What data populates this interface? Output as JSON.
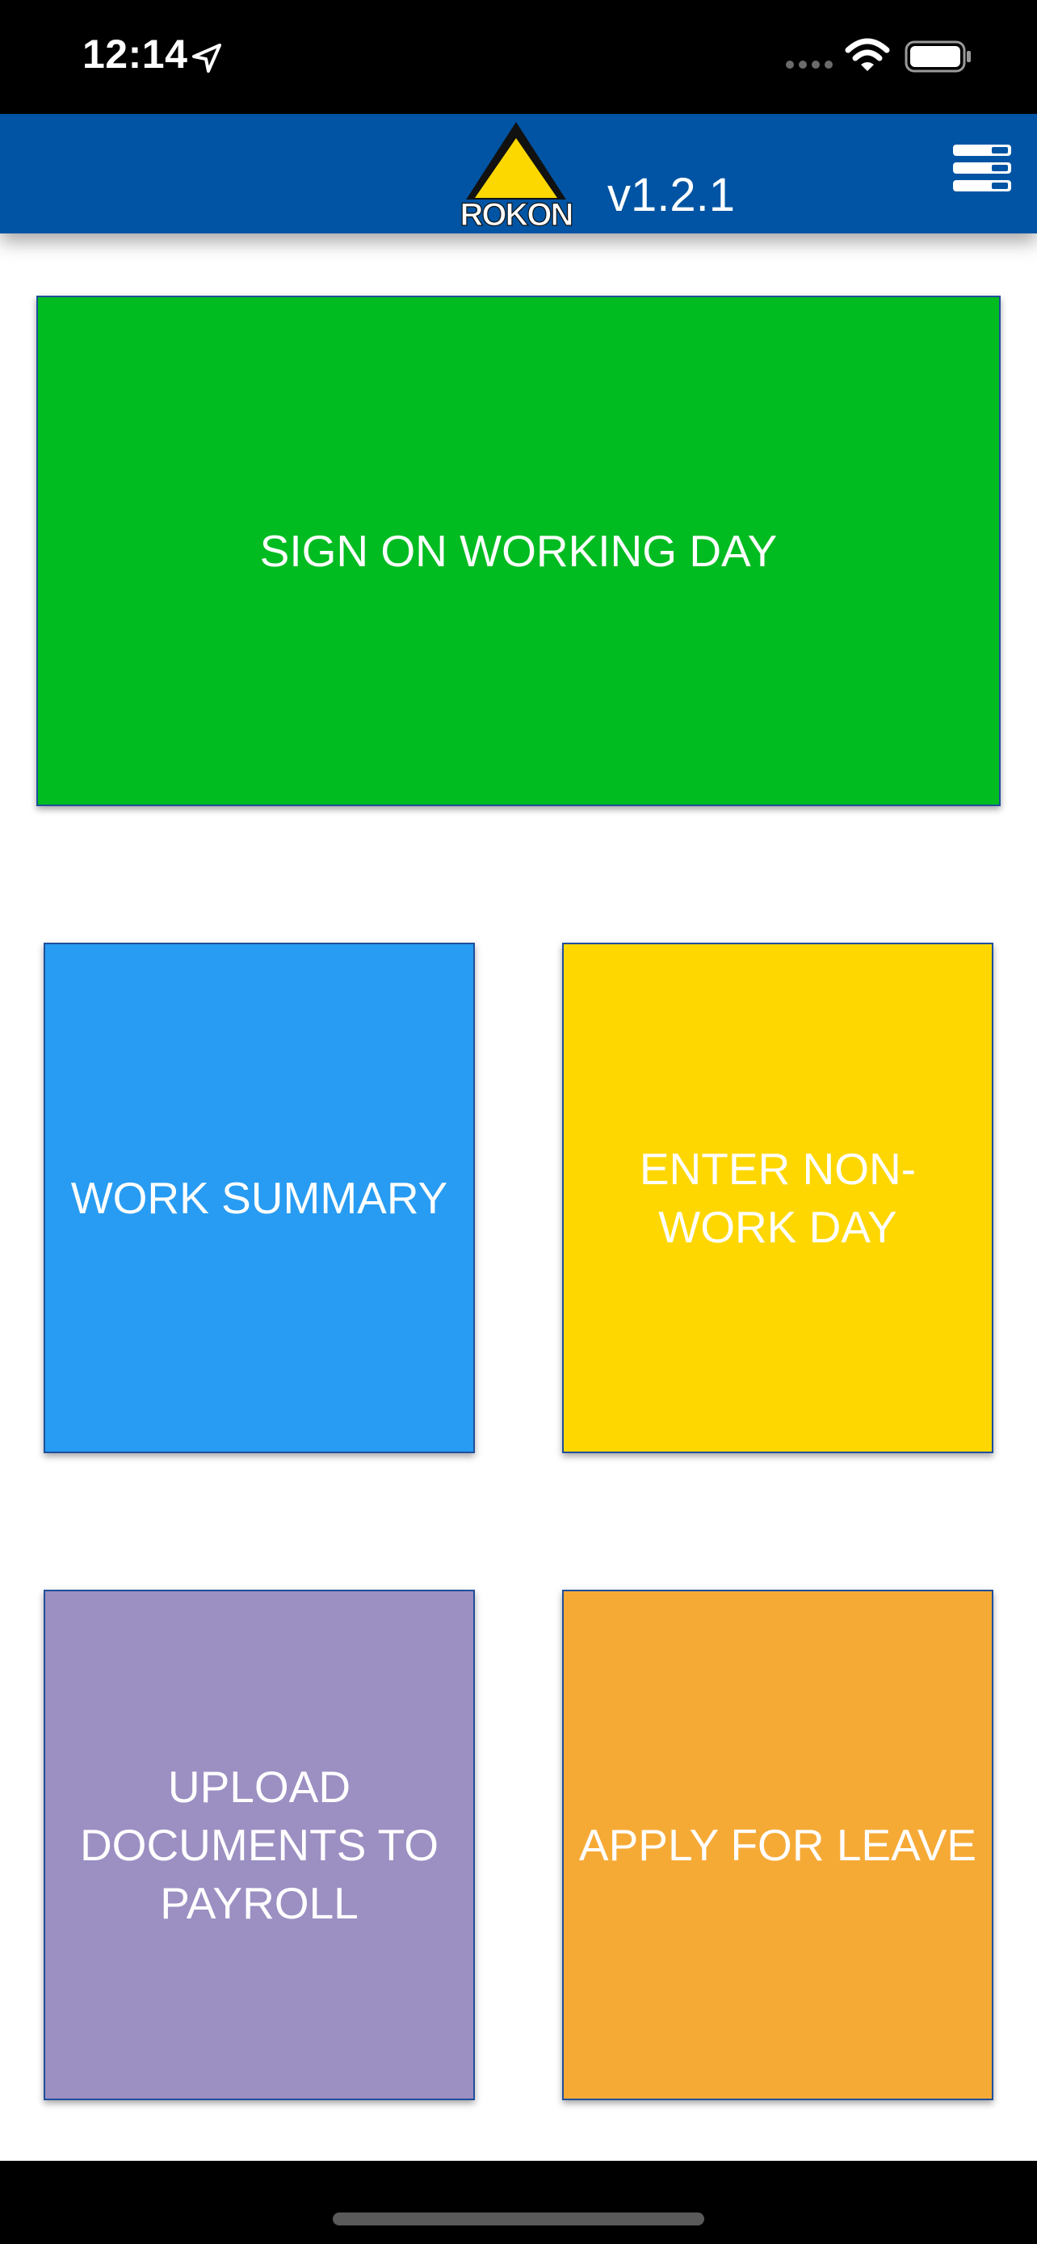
{
  "status_bar": {
    "time": "12:14"
  },
  "header": {
    "logo_text": "ROKON",
    "version": "v1.2.1",
    "menu_icon": "menu-stack-icon"
  },
  "tiles": {
    "sign_on": "SIGN ON WORKING DAY",
    "work_summary": "WORK SUMMARY",
    "non_work_day": "ENTER NON-WORK DAY",
    "upload_documents": "UPLOAD DOCUMENTS TO PAYROLL",
    "apply_leave": "APPLY FOR LEAVE"
  },
  "colors": {
    "header": "#0054a3",
    "sign_on": "#01bc21",
    "work_summary": "#289cf2",
    "non_work_day": "#fed700",
    "upload_documents": "#9c8fc2",
    "apply_leave": "#f6aa36"
  }
}
